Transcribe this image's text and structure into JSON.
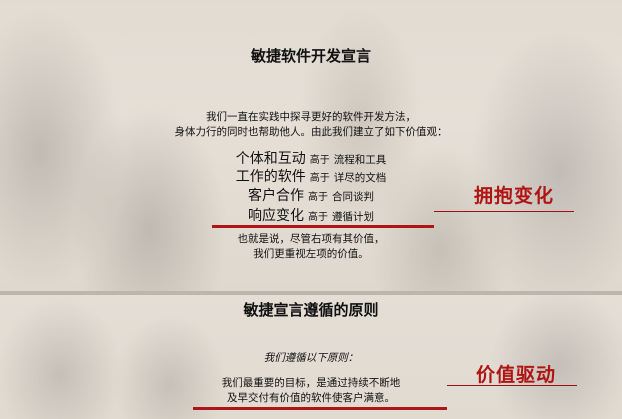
{
  "manifesto": {
    "title": "敏捷软件开发宣言",
    "intro_line1": "我们一直在实践中探寻更好的软件开发方法，",
    "intro_line2": "身体力行的同时也帮助他人。由此我们建立了如下价值观：",
    "values": [
      {
        "left": "个体和互动",
        "mid": "高于",
        "right": "流程和工具"
      },
      {
        "left": "工作的软件",
        "mid": "高于",
        "right": "详尽的文档"
      },
      {
        "left": "客户合作",
        "mid": "高于",
        "right": "合同谈判"
      },
      {
        "left": "响应变化",
        "mid": "高于",
        "right": "遵循计划"
      }
    ],
    "closing_line1": "也就是说，尽管右项有其价值，",
    "closing_line2": "我们更重视左项的价值。"
  },
  "callout_top": "拥抱变化",
  "principles": {
    "title": "敏捷宣言遵循的原则",
    "subtitle": "我们遵循以下原则：",
    "line1": "我们最重要的目标，是通过持续不断地",
    "line2": "及早交付有价值的软件使客户满意。"
  },
  "callout_bottom": "价值驱动",
  "colors": {
    "accent": "#b01515"
  }
}
